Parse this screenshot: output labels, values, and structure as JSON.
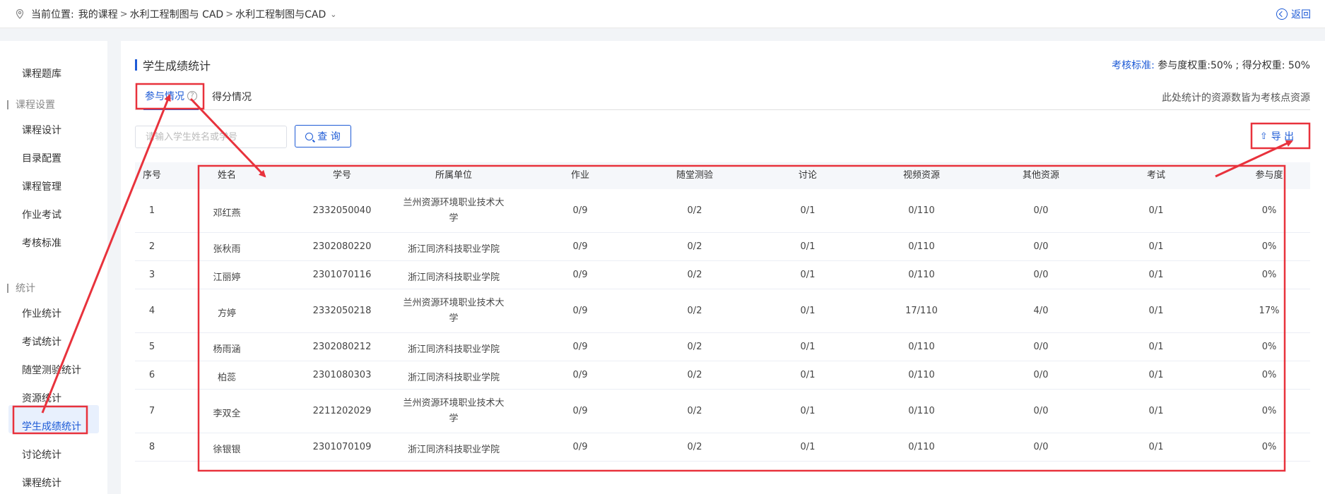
{
  "breadcrumb": {
    "prefix": "当前位置:",
    "items": [
      "我的课程",
      "水利工程制图与 CAD",
      "水利工程制图与CAD"
    ]
  },
  "back_label": "返回",
  "sidebar": {
    "items": [
      {
        "type": "item",
        "label": "课程题库"
      },
      {
        "type": "group",
        "label": "课程设置"
      },
      {
        "type": "item",
        "label": "课程设计"
      },
      {
        "type": "item",
        "label": "目录配置"
      },
      {
        "type": "item",
        "label": "课程管理"
      },
      {
        "type": "item",
        "label": "作业考试"
      },
      {
        "type": "item",
        "label": "考核标准"
      },
      {
        "type": "group",
        "label": "统计"
      },
      {
        "type": "item",
        "label": "作业统计"
      },
      {
        "type": "item",
        "label": "考试统计"
      },
      {
        "type": "item",
        "label": "随堂测验统计"
      },
      {
        "type": "item",
        "label": "资源统计"
      },
      {
        "type": "item",
        "label": "学生成绩统计",
        "active": true
      },
      {
        "type": "item",
        "label": "讨论统计"
      },
      {
        "type": "item",
        "label": "课程统计"
      }
    ]
  },
  "page_title": "学生成绩统计",
  "standard": {
    "label": "考核标准:",
    "text": "参与度权重:50% ; 得分权重: 50%"
  },
  "tabs": [
    {
      "label": "参与情况",
      "active": true
    },
    {
      "label": "得分情况",
      "active": false
    }
  ],
  "tab_note": "此处统计的资源数皆为考核点资源",
  "search": {
    "placeholder": "请输入学生姓名或学号",
    "value": ""
  },
  "query_label": "查 询",
  "export_label": "导 出",
  "table": {
    "headers": [
      "序号",
      "姓名",
      "学号",
      "所属单位",
      "作业",
      "随堂测验",
      "讨论",
      "视频资源",
      "其他资源",
      "考试",
      "参与度"
    ],
    "rows": [
      [
        "1",
        "邓红燕",
        "2332050040",
        "兰州资源环境职业技术大学",
        "0/9",
        "0/2",
        "0/1",
        "0/110",
        "0/0",
        "0/1",
        "0%"
      ],
      [
        "2",
        "张秋雨",
        "2302080220",
        "浙江同济科技职业学院",
        "0/9",
        "0/2",
        "0/1",
        "0/110",
        "0/0",
        "0/1",
        "0%"
      ],
      [
        "3",
        "江丽婷",
        "2301070116",
        "浙江同济科技职业学院",
        "0/9",
        "0/2",
        "0/1",
        "0/110",
        "0/0",
        "0/1",
        "0%"
      ],
      [
        "4",
        "方婷",
        "2332050218",
        "兰州资源环境职业技术大学",
        "0/9",
        "0/2",
        "0/1",
        "17/110",
        "4/0",
        "0/1",
        "17%"
      ],
      [
        "5",
        "杨雨涵",
        "2302080212",
        "浙江同济科技职业学院",
        "0/9",
        "0/2",
        "0/1",
        "0/110",
        "0/0",
        "0/1",
        "0%"
      ],
      [
        "6",
        "柏蕊",
        "2301080303",
        "浙江同济科技职业学院",
        "0/9",
        "0/2",
        "0/1",
        "0/110",
        "0/0",
        "0/1",
        "0%"
      ],
      [
        "7",
        "李双全",
        "2211202029",
        "兰州资源环境职业技术大学",
        "0/9",
        "0/2",
        "0/1",
        "0/110",
        "0/0",
        "0/1",
        "0%"
      ],
      [
        "8",
        "徐银银",
        "2301070109",
        "浙江同济科技职业学院",
        "0/9",
        "0/2",
        "0/1",
        "0/110",
        "0/0",
        "0/1",
        "0%"
      ]
    ]
  },
  "colors": {
    "accent": "#1e5bd6",
    "annotation": "#e8323c"
  }
}
